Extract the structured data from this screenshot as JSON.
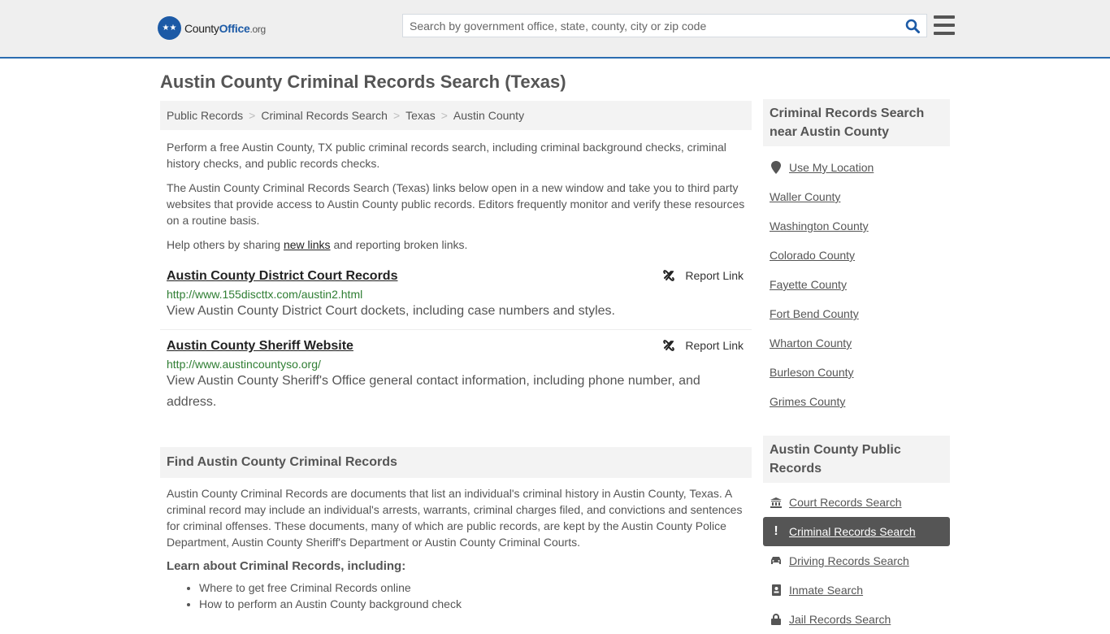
{
  "header": {
    "logo_prefix": "County",
    "logo_brand": "Office",
    "logo_suffix": ".org",
    "search_placeholder": "Search by government office, state, county, city or zip code"
  },
  "page_title": "Austin County Criminal Records Search (Texas)",
  "breadcrumb": [
    "Public Records",
    "Criminal Records Search",
    "Texas",
    "Austin County"
  ],
  "intro": {
    "p1": "Perform a free Austin County, TX public criminal records search, including criminal background checks, criminal history checks, and public records checks.",
    "p2": "The Austin County Criminal Records Search (Texas) links below open in a new window and take you to third party websites that provide access to Austin County public records. Editors frequently monitor and verify these resources on a routine basis.",
    "p3_before": "Help others by sharing ",
    "p3_link": "new links",
    "p3_after": " and reporting broken links."
  },
  "links": [
    {
      "title": "Austin County District Court Records",
      "url": "http://www.155discttx.com/austin2.html",
      "description": "View Austin County District Court dockets, including case numbers and styles.",
      "report_label": "Report Link"
    },
    {
      "title": "Austin County Sheriff Website",
      "url": "http://www.austincountyso.org/",
      "description": "View Austin County Sheriff's Office general contact information, including phone number, and address.",
      "report_label": "Report Link"
    }
  ],
  "find_section": {
    "heading": "Find Austin County Criminal Records",
    "body": "Austin County Criminal Records are documents that list an individual's criminal history in Austin County, Texas. A criminal record may include an individual's arrests, warrants, criminal charges filed, and convictions and sentences for criminal offenses. These documents, many of which are public records, are kept by the Austin County Police Department, Austin County Sheriff's Department or Austin County Criminal Courts.",
    "learn_heading": "Learn about Criminal Records, including:",
    "learn_items": [
      "Where to get free Criminal Records online",
      "How to perform an Austin County background check"
    ]
  },
  "sidebar": {
    "nearby_heading": "Criminal Records Search near Austin County",
    "use_location": "Use My Location",
    "nearby": [
      "Waller County",
      "Washington County",
      "Colorado County",
      "Fayette County",
      "Fort Bend County",
      "Wharton County",
      "Burleson County",
      "Grimes County"
    ],
    "public_heading": "Austin County Public Records",
    "public_items": [
      {
        "label": "Court Records Search",
        "icon": "bank-icon",
        "active": false
      },
      {
        "label": "Criminal Records Search",
        "icon": "exclamation-icon",
        "active": true
      },
      {
        "label": "Driving Records Search",
        "icon": "car-icon",
        "active": false
      },
      {
        "label": "Inmate Search",
        "icon": "id-badge-icon",
        "active": false
      },
      {
        "label": "Jail Records Search",
        "icon": "lock-icon",
        "active": false
      }
    ]
  }
}
